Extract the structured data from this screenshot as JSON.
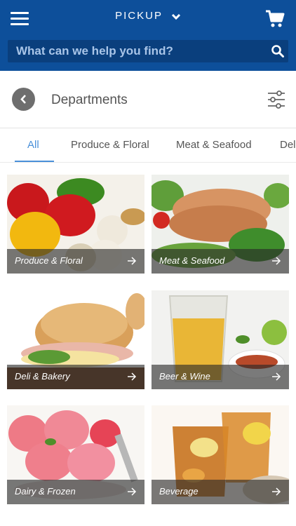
{
  "topbar": {
    "mode_label": "PICKUP",
    "search_placeholder": "What can we help you find?"
  },
  "header": {
    "title": "Departments"
  },
  "tabs": [
    {
      "label": "All",
      "active": true
    },
    {
      "label": "Produce & Floral"
    },
    {
      "label": "Meat & Seafood"
    },
    {
      "label": "Del"
    }
  ],
  "departments": [
    {
      "label": "Produce & Floral"
    },
    {
      "label": "Meat & Seafood"
    },
    {
      "label": "Deli & Bakery"
    },
    {
      "label": "Beer & Wine"
    },
    {
      "label": "Dairy & Frozen"
    },
    {
      "label": "Beverage"
    }
  ],
  "colors": {
    "brand_blue": "#0d4f9a",
    "accent_blue": "#4a90d9"
  }
}
